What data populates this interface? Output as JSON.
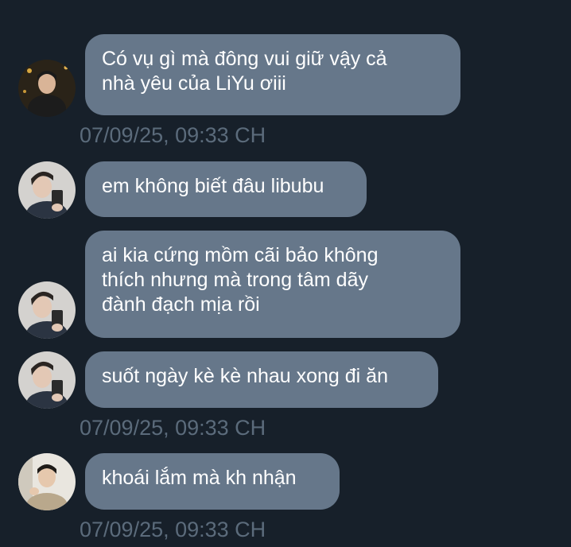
{
  "conversation": {
    "messages": [
      {
        "text": "Có vụ gì mà đông vui giữ vậy cả\nnhà yêu của LiYu ơiii",
        "avatar": "avatar-1"
      },
      {
        "text": "em không biết đâu libubu",
        "avatar": "avatar-2"
      },
      {
        "text": "ai kia cứng mồm cãi bảo không\nthích nhưng mà trong tâm dãy\nđành đạch mịa rồi",
        "avatar": "avatar-2"
      },
      {
        "text": "suốt ngày kè kè nhau xong đi ăn",
        "avatar": "avatar-2"
      },
      {
        "text": "khoái lắm mà kh nhận",
        "avatar": "avatar-3"
      }
    ],
    "timestamps": [
      "07/09/25, 09:33 CH",
      "07/09/25, 09:33 CH",
      "07/09/25, 09:33 CH"
    ]
  },
  "colors": {
    "background": "#17202a",
    "bubble": "#66778a",
    "timestamp": "#5b6b7b",
    "text": "#ffffff"
  }
}
